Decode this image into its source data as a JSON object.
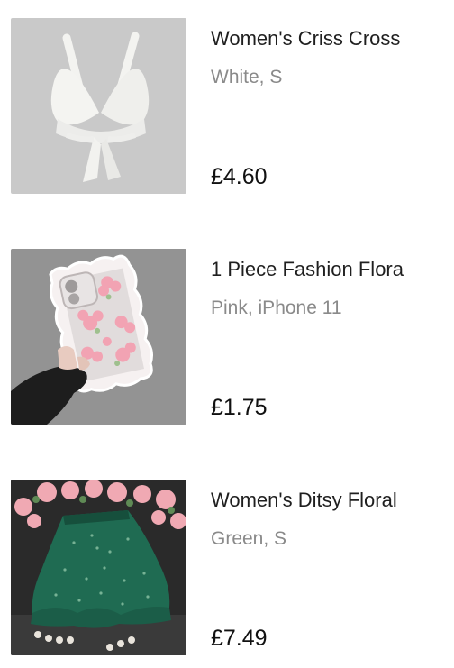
{
  "products": [
    {
      "title": "Women's Criss Cross",
      "variant": "White, S",
      "price": "£4.60",
      "image_icon": "white-bra-top-image"
    },
    {
      "title": "1 Piece Fashion Flora",
      "variant": "Pink, iPhone 11",
      "price": "£1.75",
      "image_icon": "floral-phone-case-image"
    },
    {
      "title": "Women's Ditsy Floral",
      "variant": "Green, S",
      "price": "£7.49",
      "image_icon": "green-floral-skirt-image"
    }
  ]
}
